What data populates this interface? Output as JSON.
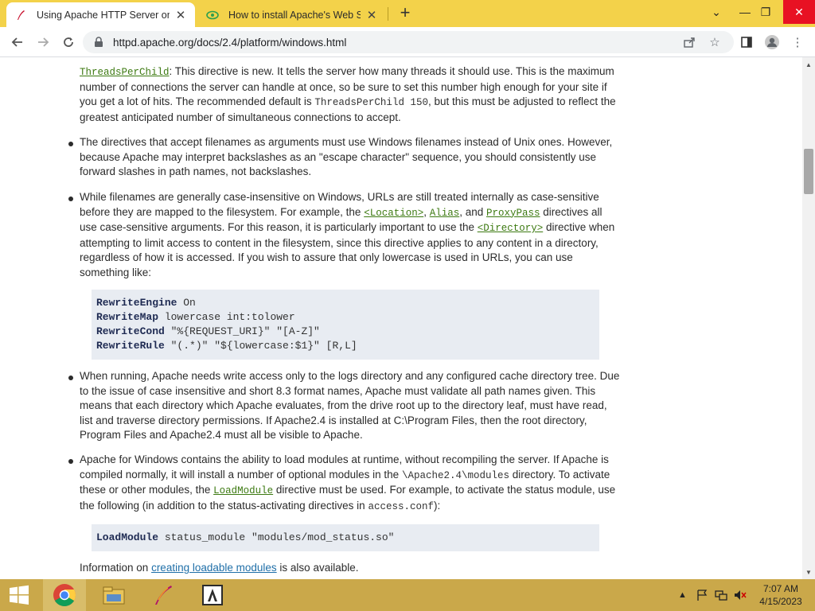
{
  "browser": {
    "tabs": [
      {
        "title": "Using Apache HTTP Server on M",
        "active": true,
        "icon": "apache-feather-icon"
      },
      {
        "title": "How to install Apache's Web Ser",
        "active": false,
        "icon": "eye-icon"
      }
    ],
    "url": "httpd.apache.org/docs/2.4/platform/windows.html",
    "window_controls": {
      "minimize": "—",
      "restore": "❐",
      "close": "✕"
    }
  },
  "doc": {
    "p1_link": "ThreadsPerChild",
    "p1_text_a": ": This directive is new. It tells the server how many threads it should use. This is the maximum number of connections the server can handle at once, so be sure to set this number high enough for your site if you get a lot of hits. The recommended default is ",
    "p1_code": "ThreadsPerChild 150",
    "p1_text_b": ", but this must be adjusted to reflect the greatest anticipated number of simultaneous connections to accept.",
    "p2": "The directives that accept filenames as arguments must use Windows filenames instead of Unix ones. However, because Apache may interpret backslashes as an \"escape character\" sequence, you should consistently use forward slashes in path names, not backslashes.",
    "p3_a": "While filenames are generally case-insensitive on Windows, URLs are still treated internally as case-sensitive before they are mapped to the filesystem. For example, the ",
    "p3_link1": "<Location>",
    "p3_sep1": ", ",
    "p3_link2": "Alias",
    "p3_sep2": ", and ",
    "p3_link3": "ProxyPass",
    "p3_b": " directives all use case-sensitive arguments. For this reason, it is particularly important to use the ",
    "p3_link4": "<Directory>",
    "p3_c": " directive when attempting to limit access to content in the filesystem, since this directive applies to any content in a directory, regardless of how it is accessed. If you wish to assure that only lowercase is used in URLs, you can use something like:",
    "code1": [
      {
        "kw": "RewriteEngine",
        "rest": " On"
      },
      {
        "kw": "RewriteMap",
        "rest": " lowercase int:tolower"
      },
      {
        "kw": "RewriteCond",
        "rest": " \"%{REQUEST_URI}\" \"[A-Z]\""
      },
      {
        "kw": "RewriteRule",
        "rest": " \"(.*)\" \"${lowercase:$1}\" [R,L]"
      }
    ],
    "p4": "When running, Apache needs write access only to the logs directory and any configured cache directory tree. Due to the issue of case insensitive and short 8.3 format names, Apache must validate all path names given. This means that each directory which Apache evaluates, from the drive root up to the directory leaf, must have read, list and traverse directory permissions. If Apache2.4 is installed at C:\\Program Files, then the root directory, Program Files and Apache2.4 must all be visible to Apache.",
    "p5_a": "Apache for Windows contains the ability to load modules at runtime, without recompiling the server. If Apache is compiled normally, it will install a number of optional modules in the ",
    "p5_code1": "\\Apache2.4\\modules",
    "p5_b": " directory. To activate these or other modules, the ",
    "p5_link": "LoadModule",
    "p5_c": " directive must be used. For example, to activate the status module, use the following (in addition to the status-activating directives in ",
    "p5_code2": "access.conf",
    "p5_d": "):",
    "code2": [
      {
        "kw": "LoadModule",
        "rest": " status_module \"modules/mod_status.so\""
      }
    ],
    "p6_a": "Information on ",
    "p6_link": "creating loadable modules",
    "p6_b": " is also available."
  },
  "taskbar": {
    "apps": [
      "chrome-icon",
      "file-explorer-icon",
      "apache-feather-icon",
      "adobe-icon"
    ],
    "time": "7:07 AM",
    "date": "4/15/2023"
  },
  "colors": {
    "tabstrip": "#f3d24a",
    "taskbar": "#caa84a",
    "link": "#3d7a12",
    "codebox": "#e8ecf2"
  }
}
